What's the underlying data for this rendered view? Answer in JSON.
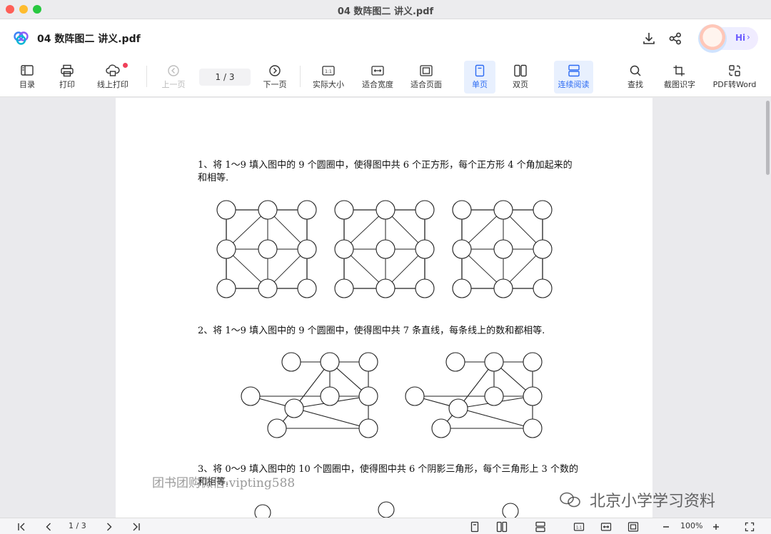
{
  "window": {
    "title": "04 数阵图二 讲义.pdf"
  },
  "header": {
    "doc_title": "04 数阵图二 讲义.pdf",
    "hi_label": "Hi"
  },
  "toolbar": {
    "contents": "目录",
    "print": "打印",
    "online_print": "线上打印",
    "prev_page": "上一页",
    "page_indicator": "1  / 3",
    "next_page": "下一页",
    "actual_size": "实际大小",
    "fit_width": "适合宽度",
    "fit_page": "适合页面",
    "single_page": "单页",
    "double_page": "双页",
    "continuous": "连续阅读",
    "find": "查找",
    "ocr": "截图识字",
    "pdf_to_word": "PDF转Word"
  },
  "document": {
    "q1_line1": "1、将 1～9 填入图中的 9 个圆圈中，使得图中共 6 个正方形，每个正方形 4 个角加起来的",
    "q1_line2": "和相等.",
    "q2": "2、将 1～9 填入图中的 9 个圆圈中，使得图中共 7 条直线，每条线上的数和都相等.",
    "q3_line1": "3、将 0～9 填入图中的 10 个圆圈中，使得图中共 6 个阴影三角形，每个三角形上 3 个数的",
    "q3_line2": "和相等."
  },
  "watermarks": {
    "left": "团书团购微信:vipting588",
    "right": "北京小学学习资料"
  },
  "statusbar": {
    "page_indicator": "1 / 3",
    "zoom": "100%"
  }
}
